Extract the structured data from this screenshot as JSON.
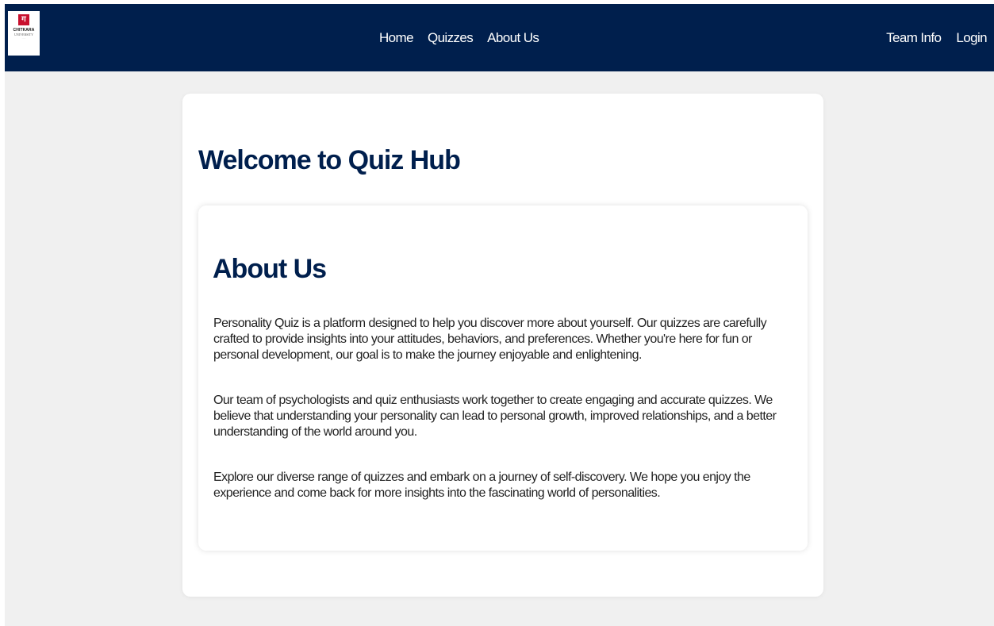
{
  "navbar": {
    "logo": {
      "name": "CHITKARA",
      "sub": "UNIVERSITY"
    },
    "center_links": [
      "Home",
      "Quizzes",
      "About Us"
    ],
    "right_links": [
      "Team Info",
      "Login"
    ]
  },
  "main": {
    "welcome_title": "Welcome to Quiz Hub",
    "about": {
      "title": "About Us",
      "paragraphs": [
        "Personality Quiz is a platform designed to help you discover more about yourself. Our quizzes are carefully crafted to provide insights into your attitudes, behaviors, and preferences. Whether you're here for fun or personal development, our goal is to make the journey enjoyable and enlightening.",
        "Our team of psychologists and quiz enthusiasts work together to create engaging and accurate quizzes. We believe that understanding your personality can lead to personal growth, improved relationships, and a better understanding of the world around you.",
        "Explore our diverse range of quizzes and embark on a journey of self-discovery. We hope you enjoy the experience and come back for more insights into the fascinating world of personalities."
      ]
    }
  },
  "colors": {
    "navbar_bg": "#001f4d",
    "heading": "#001f4d",
    "page_bg": "#f0f0f0",
    "card_bg": "#ffffff",
    "logo_accent": "#c8102e"
  }
}
